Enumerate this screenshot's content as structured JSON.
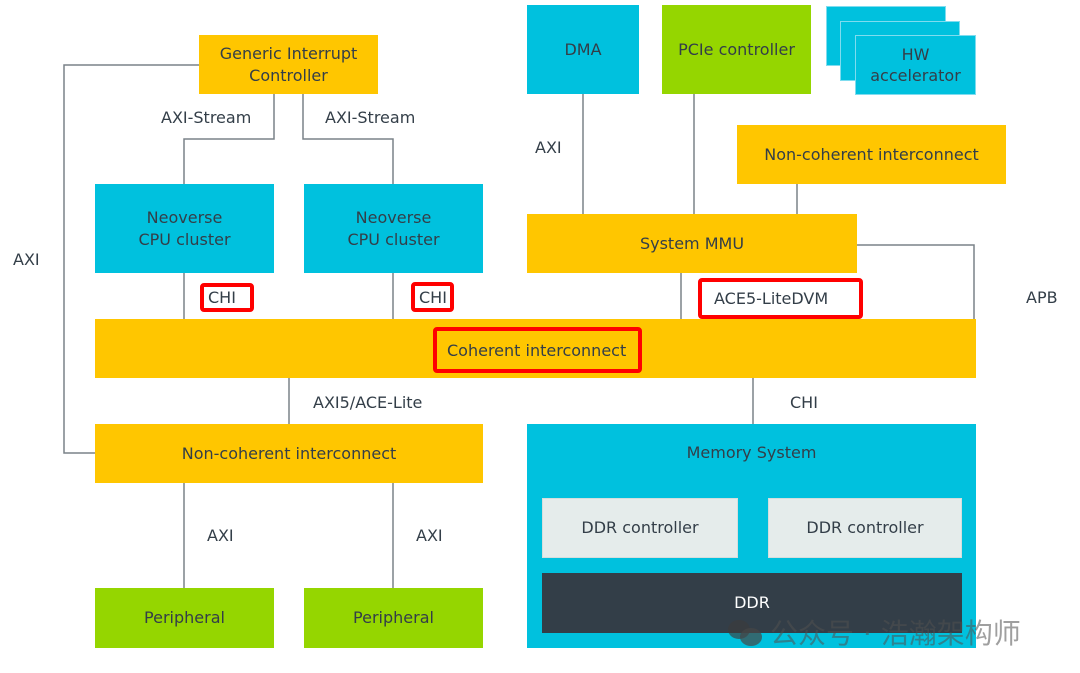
{
  "diagram": {
    "blocks": {
      "gic": "Generic Interrupt\nController",
      "cpu_cluster_1": "Neoverse\nCPU cluster",
      "cpu_cluster_2": "Neoverse\nCPU cluster",
      "dma": "DMA",
      "pcie": "PCIe controller",
      "hw_accelerator": "HW\naccelerator",
      "noncoherent_top": "Non-coherent interconnect",
      "system_mmu": "System MMU",
      "coherent_interconnect": "Coherent interconnect",
      "noncoherent_bottom": "Non-coherent interconnect",
      "memory_system": "Memory System",
      "ddr_controller_1": "DDR controller",
      "ddr_controller_2": "DDR controller",
      "ddr": "DDR",
      "peripheral_1": "Peripheral",
      "peripheral_2": "Peripheral"
    },
    "links": {
      "axi_stream_1": "AXI-Stream",
      "axi_stream_2": "AXI-Stream",
      "axi_left": "AXI",
      "chi_1": "CHI",
      "chi_2": "CHI",
      "axi_dma": "AXI",
      "ace5_litedvm": "ACE5-LiteDVM",
      "apb": "APB",
      "axi5_ace_lite": "AXI5/ACE-Lite",
      "chi_memory": "CHI",
      "axi_periph_1": "AXI",
      "axi_periph_2": "AXI"
    },
    "highlighted": [
      "chi_1",
      "chi_2",
      "ace5_litedvm",
      "coherent_interconnect"
    ],
    "colors": {
      "interconnect_yellow": "#ffc600",
      "compute_cyan": "#00c1de",
      "io_green": "#95d600",
      "controller_grey": "#e5eceb",
      "memory_dark": "#333e48",
      "highlight_red": "#ff0000",
      "wire_grey": "#7a8288"
    }
  },
  "watermark": {
    "text": "公众号 · 浩瀚架构师",
    "icon": "wechat-icon"
  }
}
